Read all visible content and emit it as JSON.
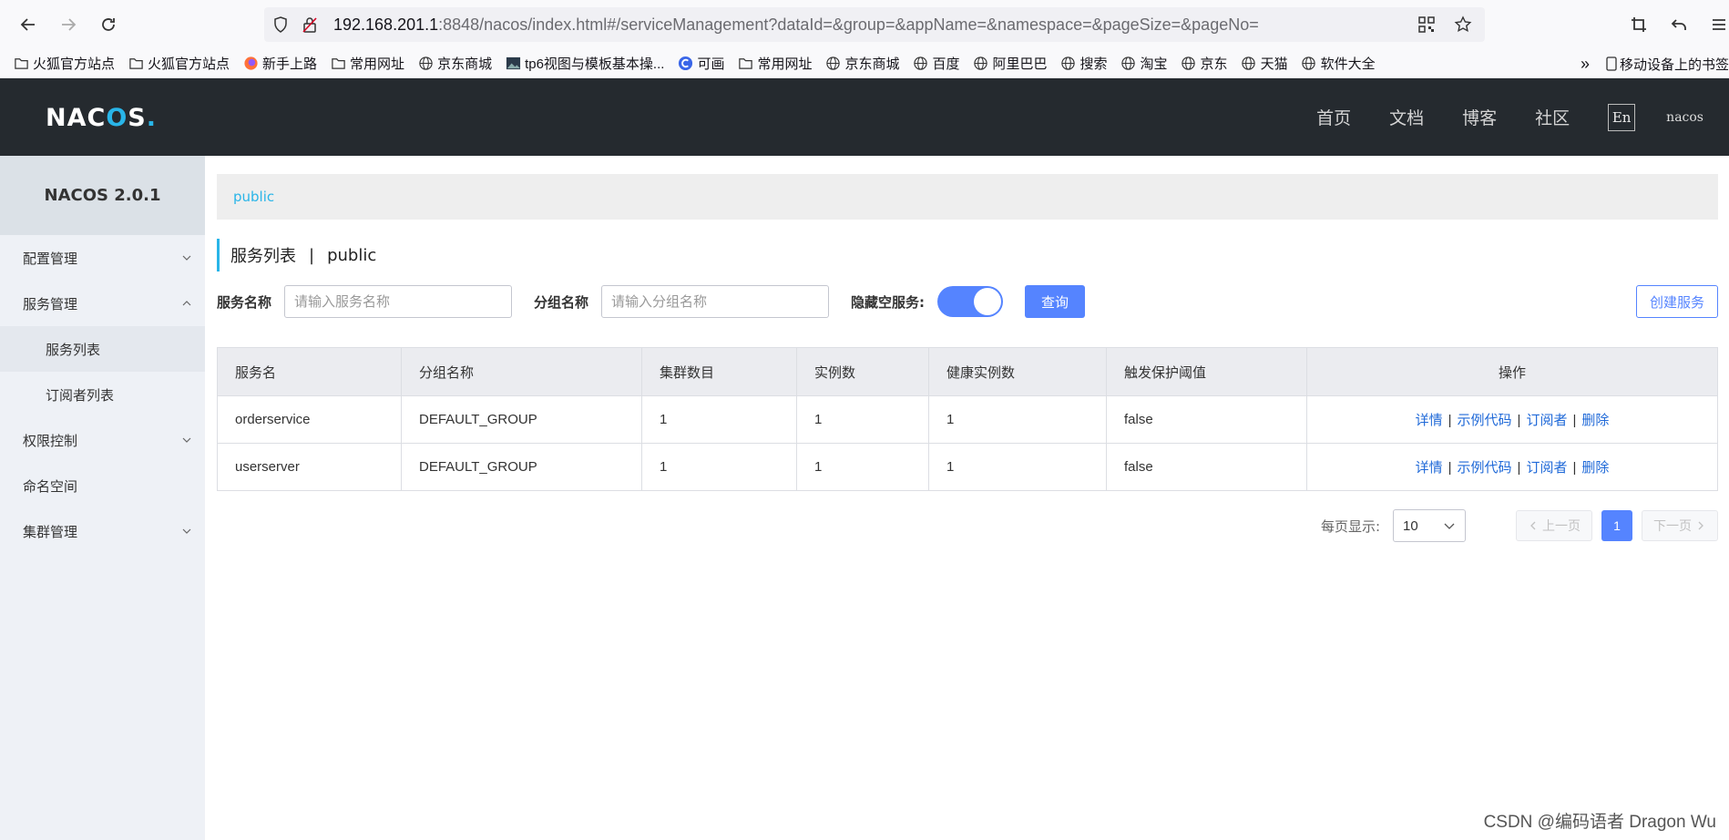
{
  "browser": {
    "url_host": "192.168.201.1",
    "url_rest": ":8848/nacos/index.html#/serviceManagement?dataId=&group=&appName=&namespace=&pageSize=&pageNo="
  },
  "bookmarks": [
    {
      "icon": "folder-icon",
      "label": "火狐官方站点"
    },
    {
      "icon": "folder-icon",
      "label": "火狐官方站点"
    },
    {
      "icon": "firefox-icon",
      "label": "新手上路"
    },
    {
      "icon": "folder-icon",
      "label": "常用网址"
    },
    {
      "icon": "globe-icon",
      "label": "京东商城"
    },
    {
      "icon": "image-icon",
      "label": "tp6视图与模板基本操..."
    },
    {
      "icon": "c-logo-icon",
      "label": "可画"
    },
    {
      "icon": "folder-icon",
      "label": "常用网址"
    },
    {
      "icon": "globe-icon",
      "label": "京东商城"
    },
    {
      "icon": "globe-icon",
      "label": "百度"
    },
    {
      "icon": "globe-icon",
      "label": "阿里巴巴"
    },
    {
      "icon": "globe-icon",
      "label": "搜索"
    },
    {
      "icon": "globe-icon",
      "label": "淘宝"
    },
    {
      "icon": "globe-icon",
      "label": "京东"
    },
    {
      "icon": "globe-icon",
      "label": "天猫"
    },
    {
      "icon": "globe-icon",
      "label": "软件大全"
    }
  ],
  "bookmarks_right": {
    "overflow": "»",
    "mobile": "移动设备上的书签"
  },
  "header": {
    "logo": {
      "n": "NAC",
      "o": "O",
      "s": "S",
      "dot": "."
    },
    "nav": [
      "首页",
      "文档",
      "博客",
      "社区"
    ],
    "lang": "En",
    "user": "nacos"
  },
  "sidebar": {
    "title": "NACOS 2.0.1",
    "items": [
      {
        "label": "配置管理",
        "expanded": false
      },
      {
        "label": "服务管理",
        "expanded": true
      },
      {
        "label": "服务列表",
        "sub": true,
        "active": true
      },
      {
        "label": "订阅者列表",
        "sub": true
      },
      {
        "label": "权限控制",
        "expanded": false
      },
      {
        "label": "命名空间"
      },
      {
        "label": "集群管理",
        "expanded": false
      }
    ]
  },
  "main": {
    "namespace_tab": "public",
    "title": "服务列表",
    "title_sep": "|",
    "title_ns": "public",
    "filters": {
      "service_label": "服务名称",
      "service_placeholder": "请输入服务名称",
      "group_label": "分组名称",
      "group_placeholder": "请输入分组名称",
      "hide_empty_label": "隐藏空服务:",
      "hide_empty_on": true,
      "query_button": "查询",
      "create_button": "创建服务"
    },
    "table": {
      "columns": [
        "服务名",
        "分组名称",
        "集群数目",
        "实例数",
        "健康实例数",
        "触发保护阈值",
        "操作"
      ],
      "rows": [
        {
          "name": "orderservice",
          "group": "DEFAULT_GROUP",
          "clusters": "1",
          "instances": "1",
          "healthy": "1",
          "threshold": "false"
        },
        {
          "name": "userserver",
          "group": "DEFAULT_GROUP",
          "clusters": "1",
          "instances": "1",
          "healthy": "1",
          "threshold": "false"
        }
      ],
      "ops": {
        "detail": "详情",
        "sample": "示例代码",
        "subscriber": "订阅者",
        "delete": "删除",
        "sep": "|"
      }
    },
    "pager": {
      "per_page_label": "每页显示:",
      "per_page_value": "10",
      "prev": "上一页",
      "next": "下一页",
      "current": "1"
    }
  },
  "watermark": "CSDN @编码语者 Dragon Wu",
  "colors": {
    "accent": "#5584ff",
    "brand": "#29b5e8",
    "header_bg": "#252a2f",
    "link": "#1f69d8"
  }
}
